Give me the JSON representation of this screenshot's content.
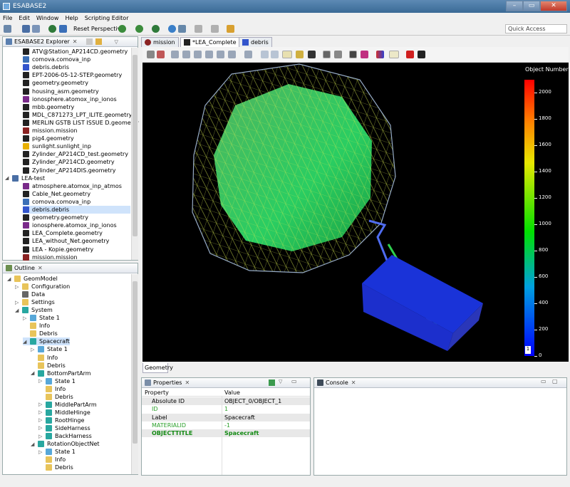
{
  "window": {
    "title": "ESABASE2",
    "minimize": "–",
    "maximize": "▭",
    "close": "✕"
  },
  "menu": [
    "File",
    "Edit",
    "Window",
    "Help",
    "Scripting Editor"
  ],
  "toolbar": {
    "reset_perspective": "Reset Perspective",
    "quick_access": "Quick Access"
  },
  "explorer": {
    "title": "ESABASE2 Explorer",
    "items": [
      {
        "label": "ATV@Station_AP214CD.geometry",
        "icon": "geometry-icon",
        "color": "#222222"
      },
      {
        "label": "comova.comova_inp",
        "icon": "comova-icon",
        "color": "#3b6fb6"
      },
      {
        "label": "debris.debris",
        "icon": "debris-icon",
        "color": "#3355cc"
      },
      {
        "label": "EPT-2006-05-12-STEP.geometry",
        "icon": "geometry-icon",
        "color": "#222222"
      },
      {
        "label": "geometry.geometry",
        "icon": "geometry-icon",
        "color": "#222222"
      },
      {
        "label": "housing_asm.geometry",
        "icon": "geometry-icon",
        "color": "#222222"
      },
      {
        "label": "ionosphere.atomox_inp_ionos",
        "icon": "ionosphere-icon",
        "color": "#7a2a8a"
      },
      {
        "label": "mbb.geometry",
        "icon": "geometry-icon",
        "color": "#222222"
      },
      {
        "label": "MDL_C871273_LPT_ILITE.geometry",
        "icon": "geometry-icon",
        "color": "#222222"
      },
      {
        "label": "MERLIN GSTB LIST ISSUE D.geometry",
        "icon": "geometry-icon",
        "color": "#222222"
      },
      {
        "label": "mission.mission",
        "icon": "mission-icon",
        "color": "#8a2222"
      },
      {
        "label": "pig4.geometry",
        "icon": "geometry-icon",
        "color": "#222222"
      },
      {
        "label": "sunlight.sunlight_inp",
        "icon": "sunlight-icon",
        "color": "#e8b000"
      },
      {
        "label": "Zylinder_AP214CD_test.geometry",
        "icon": "geometry-icon",
        "color": "#222222"
      },
      {
        "label": "Zylinder_AP214CD.geometry",
        "icon": "geometry-icon",
        "color": "#222222"
      },
      {
        "label": "Zylinder_AP214DIS.geometry",
        "icon": "geometry-icon",
        "color": "#222222"
      },
      {
        "label": "LEA-test",
        "icon": "project-folder-icon",
        "color": "#4a6fa5",
        "project": true
      },
      {
        "label": "atmosphere.atomox_inp_atmos",
        "icon": "atmosphere-icon",
        "color": "#7a2a8a"
      },
      {
        "label": "Cable_Net.geometry",
        "icon": "geometry-icon",
        "color": "#222222"
      },
      {
        "label": "comova.comova_inp",
        "icon": "comova-icon",
        "color": "#3b6fb6"
      },
      {
        "label": "debris.debris",
        "icon": "debris-icon",
        "color": "#3355cc",
        "selected": true
      },
      {
        "label": "geometry.geometry",
        "icon": "geometry-icon",
        "color": "#222222"
      },
      {
        "label": "ionosphere.atomox_inp_ionos",
        "icon": "ionosphere-icon",
        "color": "#7a2a8a"
      },
      {
        "label": "LEA_Complete.geometry",
        "icon": "geometry-icon",
        "color": "#222222"
      },
      {
        "label": "LEA_without_Net.geometry",
        "icon": "geometry-icon",
        "color": "#222222"
      },
      {
        "label": "LEA - Kopie.geometry",
        "icon": "geometry-icon",
        "color": "#222222"
      },
      {
        "label": "mission.mission",
        "icon": "mission-icon",
        "color": "#8a2222"
      }
    ]
  },
  "outline": {
    "title": "Outline",
    "items": [
      {
        "label": "GeomModel",
        "depth": 0,
        "icon": "folder-icon",
        "color": "#e8c45a",
        "twisty": "◢"
      },
      {
        "label": "Configuration",
        "depth": 1,
        "icon": "folder-icon",
        "color": "#e8c45a",
        "twisty": "▷"
      },
      {
        "label": "Data",
        "depth": 1,
        "icon": "data-icon",
        "color": "#666666",
        "twisty": ""
      },
      {
        "label": "Settings",
        "depth": 1,
        "icon": "folder-icon",
        "color": "#e8c45a",
        "twisty": "▷"
      },
      {
        "label": "System",
        "depth": 1,
        "icon": "system-icon",
        "color": "#28a7a0",
        "twisty": "◢"
      },
      {
        "label": "State 1",
        "depth": 2,
        "icon": "state-icon",
        "color": "#57a7d8",
        "twisty": "▷"
      },
      {
        "label": "Info",
        "depth": 2,
        "icon": "folder-icon",
        "color": "#e8c45a",
        "twisty": ""
      },
      {
        "label": "Debris",
        "depth": 2,
        "icon": "folder-icon",
        "color": "#e8c45a",
        "twisty": ""
      },
      {
        "label": "Spacecraft",
        "depth": 2,
        "icon": "spacecraft-icon",
        "color": "#28a7a0",
        "twisty": "◢",
        "selected": true
      },
      {
        "label": "State 1",
        "depth": 3,
        "icon": "state-icon",
        "color": "#57a7d8",
        "twisty": "▷"
      },
      {
        "label": "Info",
        "depth": 3,
        "icon": "folder-icon",
        "color": "#e8c45a",
        "twisty": ""
      },
      {
        "label": "Debris",
        "depth": 3,
        "icon": "folder-icon",
        "color": "#e8c45a",
        "twisty": ""
      },
      {
        "label": "BottomPartArm",
        "depth": 3,
        "icon": "component-icon",
        "color": "#28a7a0",
        "twisty": "◢"
      },
      {
        "label": "State 1",
        "depth": 4,
        "icon": "state-icon",
        "color": "#57a7d8",
        "twisty": "▷"
      },
      {
        "label": "Info",
        "depth": 4,
        "icon": "folder-icon",
        "color": "#e8c45a",
        "twisty": ""
      },
      {
        "label": "Debris",
        "depth": 4,
        "icon": "folder-icon",
        "color": "#e8c45a",
        "twisty": ""
      },
      {
        "label": "MiddlePartArm",
        "depth": 4,
        "icon": "component-icon",
        "color": "#28a7a0",
        "twisty": "▷"
      },
      {
        "label": "MiddleHinge",
        "depth": 4,
        "icon": "component-icon",
        "color": "#28a7a0",
        "twisty": "▷"
      },
      {
        "label": "RootHinge",
        "depth": 4,
        "icon": "component-icon",
        "color": "#28a7a0",
        "twisty": "▷"
      },
      {
        "label": "SideHarness",
        "depth": 4,
        "icon": "component-icon",
        "color": "#28a7a0",
        "twisty": "▷"
      },
      {
        "label": "BackHarness",
        "depth": 4,
        "icon": "component-icon",
        "color": "#28a7a0",
        "twisty": "▷"
      },
      {
        "label": "RotationObjectNet",
        "depth": 3,
        "icon": "component-icon",
        "color": "#28a7a0",
        "twisty": "◢"
      },
      {
        "label": "State 1",
        "depth": 4,
        "icon": "state-icon",
        "color": "#57a7d8",
        "twisty": "▷"
      },
      {
        "label": "Info",
        "depth": 4,
        "icon": "folder-icon",
        "color": "#e8c45a",
        "twisty": ""
      },
      {
        "label": "Debris",
        "depth": 4,
        "icon": "folder-icon",
        "color": "#e8c45a",
        "twisty": ""
      }
    ]
  },
  "editor_tabs": [
    {
      "label": "mission",
      "icon": "mission-icon",
      "color": "#8a2222",
      "active": false
    },
    {
      "label": "*LEA_Complete",
      "icon": "geometry-icon",
      "color": "#222222",
      "active": true
    },
    {
      "label": "debris",
      "icon": "debris-icon",
      "color": "#3355cc",
      "active": false
    }
  ],
  "legend": {
    "title": "Object Number",
    "ticks": [
      "2000",
      "1800",
      "1600",
      "1400",
      "1200",
      "1000",
      "800",
      "600",
      "400",
      "200",
      "0"
    ],
    "max": 2100,
    "axis_badge": "1"
  },
  "geometry_tab": "Geometry",
  "properties": {
    "title": "Properties",
    "col_property": "Property",
    "col_value": "Value",
    "rows": [
      {
        "property": "Absolute ID",
        "value": "OBJECT_0/OBJECT_1",
        "style": "normal"
      },
      {
        "property": "ID",
        "value": "1",
        "style": "green"
      },
      {
        "property": "Label",
        "value": "Spacecraft",
        "style": "normal"
      },
      {
        "property": "MATERIALID",
        "value": "-1",
        "style": "green"
      },
      {
        "property": "OBJECTTITLE",
        "value": "Spacecraft",
        "style": "bold-green"
      }
    ]
  },
  "console": {
    "title": "Console"
  }
}
